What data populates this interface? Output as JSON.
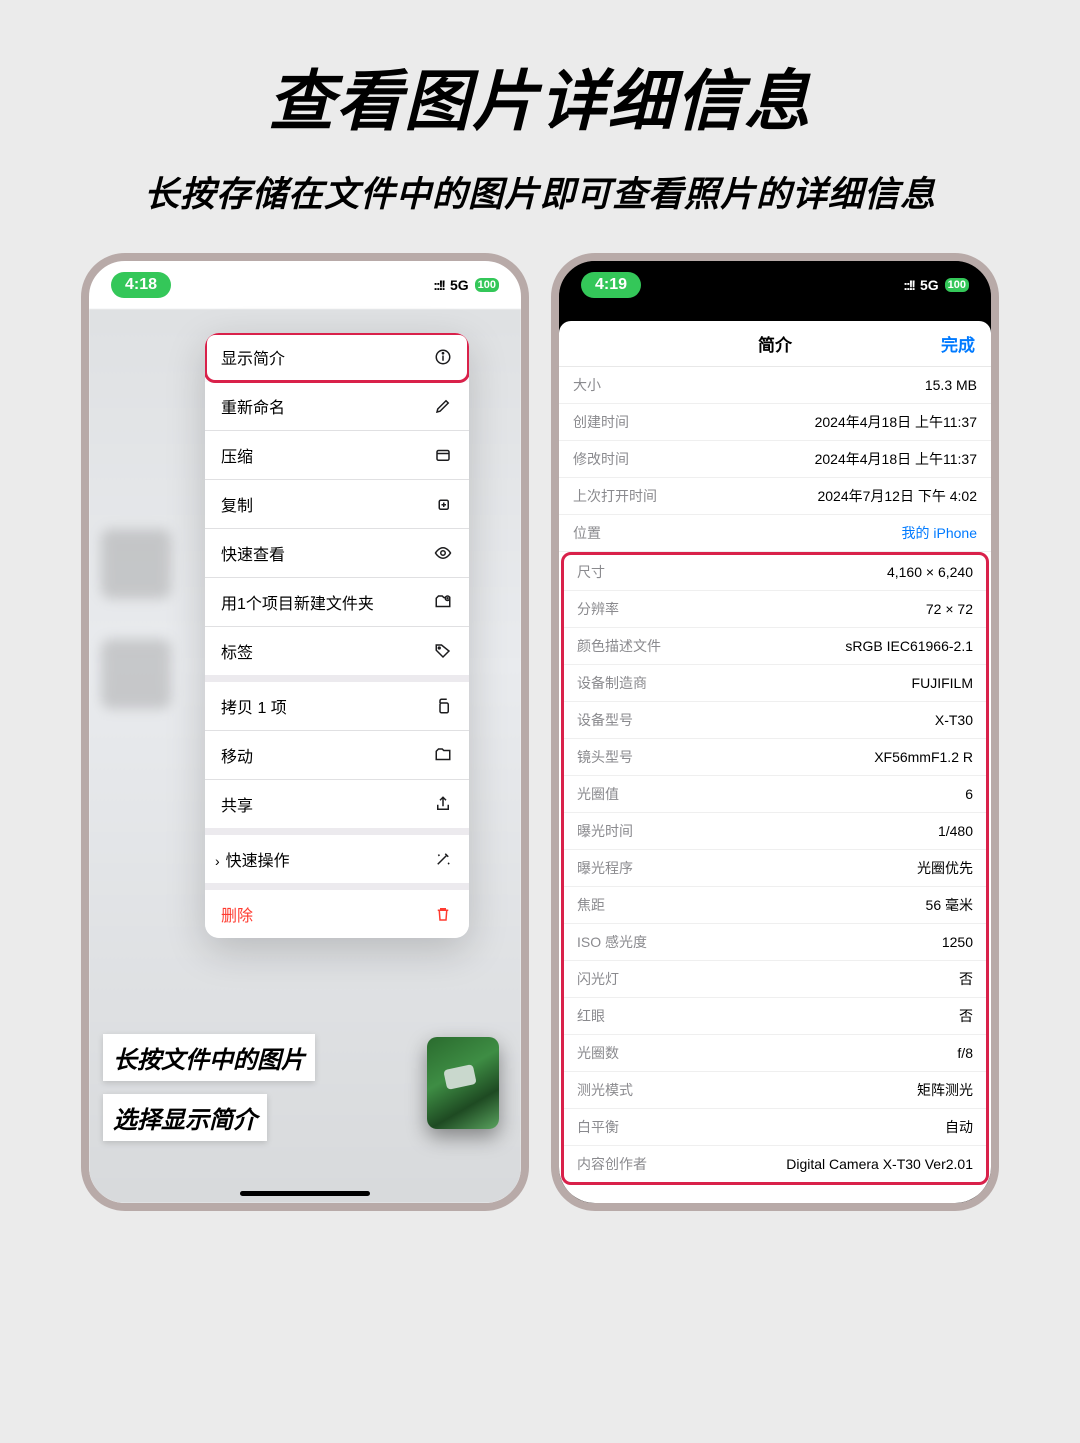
{
  "header": {
    "title": "查看图片详细信息",
    "subtitle": "长按存储在文件中的图片即可查看照片的详细信息"
  },
  "phone1": {
    "status": {
      "time": "4:18",
      "network": "5G",
      "battery": "100"
    },
    "menu": {
      "show_info": "显示简介",
      "rename": "重新命名",
      "compress": "压缩",
      "copy": "复制",
      "quick_look": "快速查看",
      "new_folder": "用1个项目新建文件夹",
      "tags": "标签",
      "duplicate": "拷贝 1 项",
      "move": "移动",
      "share": "共享",
      "quick_actions": "快速操作",
      "delete": "删除"
    },
    "caption1": "长按文件中的图片",
    "caption2": "选择显示简介"
  },
  "phone2": {
    "status": {
      "time": "4:19",
      "network": "5G",
      "battery": "100"
    },
    "sheet_title": "简介",
    "done": "完成",
    "rows_top": [
      {
        "k": "大小",
        "v": "15.3 MB"
      },
      {
        "k": "创建时间",
        "v": "2024年4月18日 上午11:37"
      },
      {
        "k": "修改时间",
        "v": "2024年4月18日 上午11:37"
      },
      {
        "k": "上次打开时间",
        "v": "2024年7月12日 下午 4:02"
      },
      {
        "k": "位置",
        "v": "我的 iPhone",
        "link": true
      }
    ],
    "rows_detail": [
      {
        "k": "尺寸",
        "v": "4,160 × 6,240"
      },
      {
        "k": "分辨率",
        "v": "72 × 72"
      },
      {
        "k": "颜色描述文件",
        "v": "sRGB IEC61966-2.1"
      },
      {
        "k": "设备制造商",
        "v": "FUJIFILM"
      },
      {
        "k": "设备型号",
        "v": "X-T30"
      },
      {
        "k": "镜头型号",
        "v": "XF56mmF1.2 R"
      },
      {
        "k": "光圈值",
        "v": "6"
      },
      {
        "k": "曝光时间",
        "v": "1/480"
      },
      {
        "k": "曝光程序",
        "v": "光圈优先"
      },
      {
        "k": "焦距",
        "v": "56 毫米"
      },
      {
        "k": "ISO 感光度",
        "v": "1250"
      },
      {
        "k": "闪光灯",
        "v": "否"
      },
      {
        "k": "红眼",
        "v": "否"
      },
      {
        "k": "光圈数",
        "v": "f/8"
      },
      {
        "k": "测光模式",
        "v": "矩阵测光"
      },
      {
        "k": "白平衡",
        "v": "自动"
      },
      {
        "k": "内容创作者",
        "v": "Digital Camera X-T30 Ver2.01"
      }
    ]
  }
}
